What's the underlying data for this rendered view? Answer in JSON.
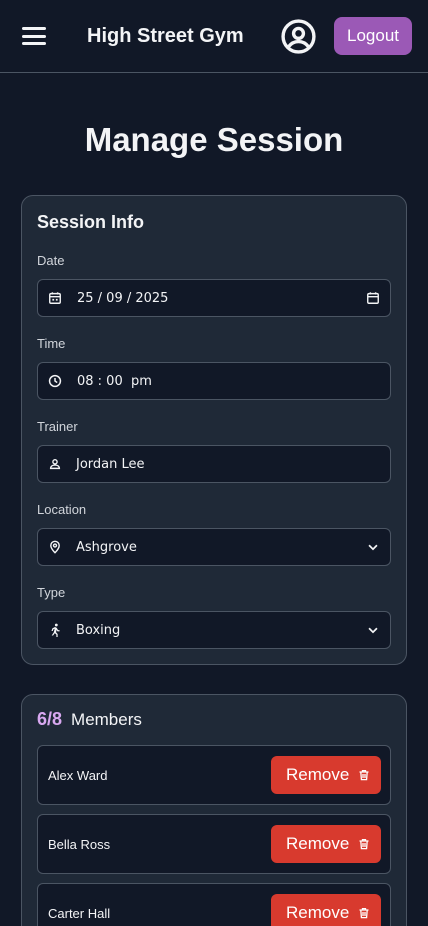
{
  "header": {
    "menu_icon": "hamburger-icon",
    "title": "High Street Gym",
    "profile_icon": "user-circle-icon",
    "logout_label": "Logout",
    "logout_color": "#9b59b6"
  },
  "page": {
    "title": "Manage Session"
  },
  "session_info": {
    "title": "Session Info",
    "fields": [
      {
        "label": "Date",
        "value": "25 / 09 / 2025",
        "icon": "calendar-icon",
        "right_icon": "calendar-picker-icon"
      },
      {
        "label": "Time",
        "value": "08 : 00  pm",
        "icon": "clock-icon"
      },
      {
        "label": "Trainer",
        "value": "Jordan Lee",
        "icon": "person-icon"
      },
      {
        "label": "Location",
        "value": "Ashgrove",
        "icon": "map-pin-icon",
        "right_icon": "chevron-down-icon"
      },
      {
        "label": "Type",
        "value": "Boxing",
        "icon": "running-person-icon",
        "right_icon": "chevron-down-icon"
      }
    ]
  },
  "members": {
    "count": "6/8",
    "label": "Members",
    "remove_label": "Remove",
    "remove_color": "#d83a2e",
    "list": [
      {
        "name": "Alex Ward"
      },
      {
        "name": "Bella Ross"
      },
      {
        "name": "Carter Hall"
      }
    ]
  }
}
